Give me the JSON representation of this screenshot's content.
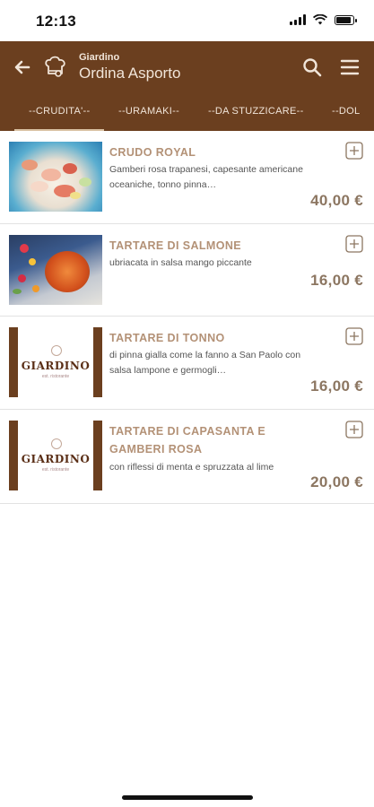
{
  "status_bar": {
    "time": "12:13"
  },
  "header": {
    "brand": "Giardino",
    "title": "Ordina Asporto",
    "background": "#6b3f1f"
  },
  "tabs": [
    {
      "label": "--CRUDITA'--",
      "active": true
    },
    {
      "label": "--URAMAKI--",
      "active": false
    },
    {
      "label": "--DA STUZZICARE--",
      "active": false
    },
    {
      "label": "--DOL",
      "active": false
    }
  ],
  "items": [
    {
      "name": "CRUDO ROYAL",
      "description": "Gamberi rosa trapanesi, capesante americane oceaniche, tonno pinna…",
      "price": "40,00 €",
      "image": "raw-seafood-platter"
    },
    {
      "name": "TARTARE DI SALMONE",
      "description": "ubriacata in salsa mango piccante",
      "price": "16,00 €",
      "image": "salmon-tartare"
    },
    {
      "name": "TARTARE DI TONNO",
      "description": "di pinna gialla come la fanno a San Paolo con salsa lampone e germogli…",
      "price": "16,00 €",
      "image": "giardino-logo-card"
    },
    {
      "name": "TARTARE DI CAPASANTA E GAMBERI ROSA",
      "description": "con riflessi di menta e spruzzata al lime",
      "price": "20,00 €",
      "image": "giardino-logo-card"
    }
  ],
  "logo_card": {
    "word": "GIARDINO",
    "sub": "est. ristorante"
  }
}
